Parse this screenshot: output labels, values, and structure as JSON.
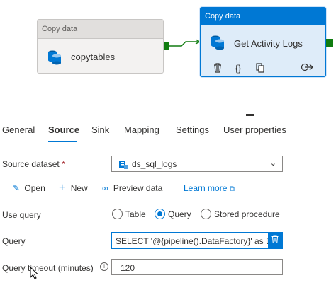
{
  "pipeline": {
    "activities": [
      {
        "type_label": "Copy data",
        "name": "copytables",
        "selected": false
      },
      {
        "type_label": "Copy data",
        "name": "Get Activity Logs",
        "selected": true
      }
    ],
    "selected_actions": [
      "delete-icon",
      "code-icon",
      "copy-icon",
      "output-icon"
    ]
  },
  "tabs": [
    "General",
    "Source",
    "Sink",
    "Mapping",
    "Settings",
    "User properties"
  ],
  "active_tab": "Source",
  "source": {
    "dataset_label": "Source dataset",
    "required_marker": "*",
    "dataset_value": "ds_sql_logs",
    "toolbar": {
      "open": "Open",
      "new": "New",
      "preview": "Preview data",
      "learn_more": "Learn more"
    },
    "use_query_label": "Use query",
    "use_query_options": [
      "Table",
      "Query",
      "Stored procedure"
    ],
    "use_query_selected": "Query",
    "query_label": "Query",
    "query_value": "SELECT '@{pipeline().DataFactory}' as DataFactory_Name,",
    "timeout_label": "Query timeout (minutes)",
    "timeout_value": "120"
  },
  "colors": {
    "accent": "#0078d4",
    "connector": "#107c10",
    "required": "#a4262c"
  }
}
